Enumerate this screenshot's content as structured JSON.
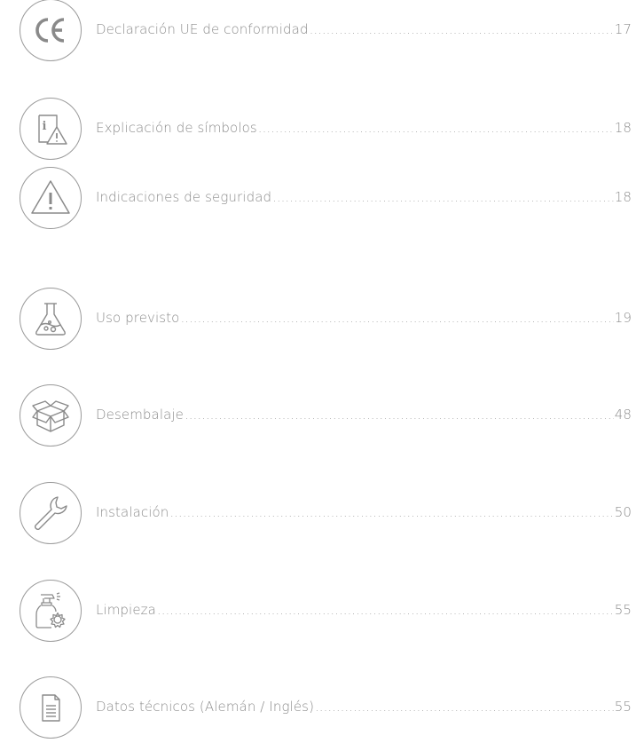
{
  "toc": {
    "entries": [
      {
        "icon": "ce-mark-icon",
        "title": "Declaración UE de conformidad",
        "page": "17"
      },
      {
        "icon": "info-warning-icon",
        "title": "Explicación de símbolos",
        "page": "18"
      },
      {
        "icon": "warning-triangle-icon",
        "title": "Indicaciones de seguridad",
        "page": "18"
      },
      {
        "icon": "lab-flask-icon",
        "title": "Uso previsto",
        "page": "19"
      },
      {
        "icon": "open-box-icon",
        "title": "Desembalaje",
        "page": "48"
      },
      {
        "icon": "wrench-icon",
        "title": "Instalación",
        "page": "50"
      },
      {
        "icon": "cleaning-spray-icon",
        "title": "Limpieza",
        "page": "55"
      },
      {
        "icon": "document-icon",
        "title": "Datos técnicos (Alemán / Inglés)",
        "page": "55"
      }
    ]
  }
}
